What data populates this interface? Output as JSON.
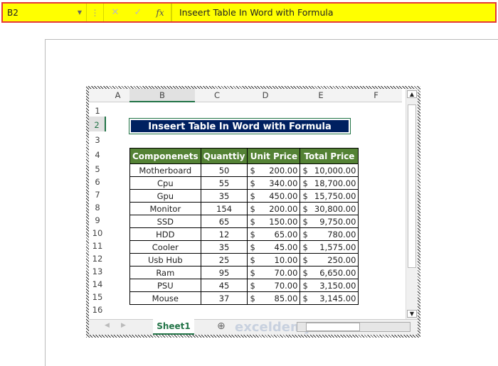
{
  "formula_bar": {
    "name_box": "B2",
    "formula": "Inseert Table In Word with Formula"
  },
  "sheet": {
    "columns": [
      "A",
      "B",
      "C",
      "D",
      "E",
      "F"
    ],
    "rows": [
      "1",
      "2",
      "3",
      "4",
      "5",
      "6",
      "7",
      "8",
      "9",
      "10",
      "11",
      "12",
      "13",
      "14",
      "15",
      "16"
    ],
    "title": "Inseert Table In Word with Formula",
    "headers": [
      "Componenets",
      "Quanttiy",
      "Unit Price",
      "Total Price"
    ],
    "data": [
      [
        "Motherboard",
        "50",
        "200.00",
        "10,000.00"
      ],
      [
        "Cpu",
        "55",
        "340.00",
        "18,700.00"
      ],
      [
        "Gpu",
        "35",
        "450.00",
        "15,750.00"
      ],
      [
        "Monitor",
        "154",
        "200.00",
        "30,800.00"
      ],
      [
        "SSD",
        "65",
        "150.00",
        "9,750.00"
      ],
      [
        "HDD",
        "12",
        "65.00",
        "780.00"
      ],
      [
        "Cooler",
        "35",
        "45.00",
        "1,575.00"
      ],
      [
        "Usb Hub",
        "25",
        "10.00",
        "250.00"
      ],
      [
        "Ram",
        "95",
        "70.00",
        "6,650.00"
      ],
      [
        "PSU",
        "45",
        "70.00",
        "3,150.00"
      ],
      [
        "Mouse",
        "37",
        "85.00",
        "3,145.00"
      ]
    ],
    "currency": "$",
    "tab": "Sheet1"
  },
  "watermark": "exceldemy"
}
